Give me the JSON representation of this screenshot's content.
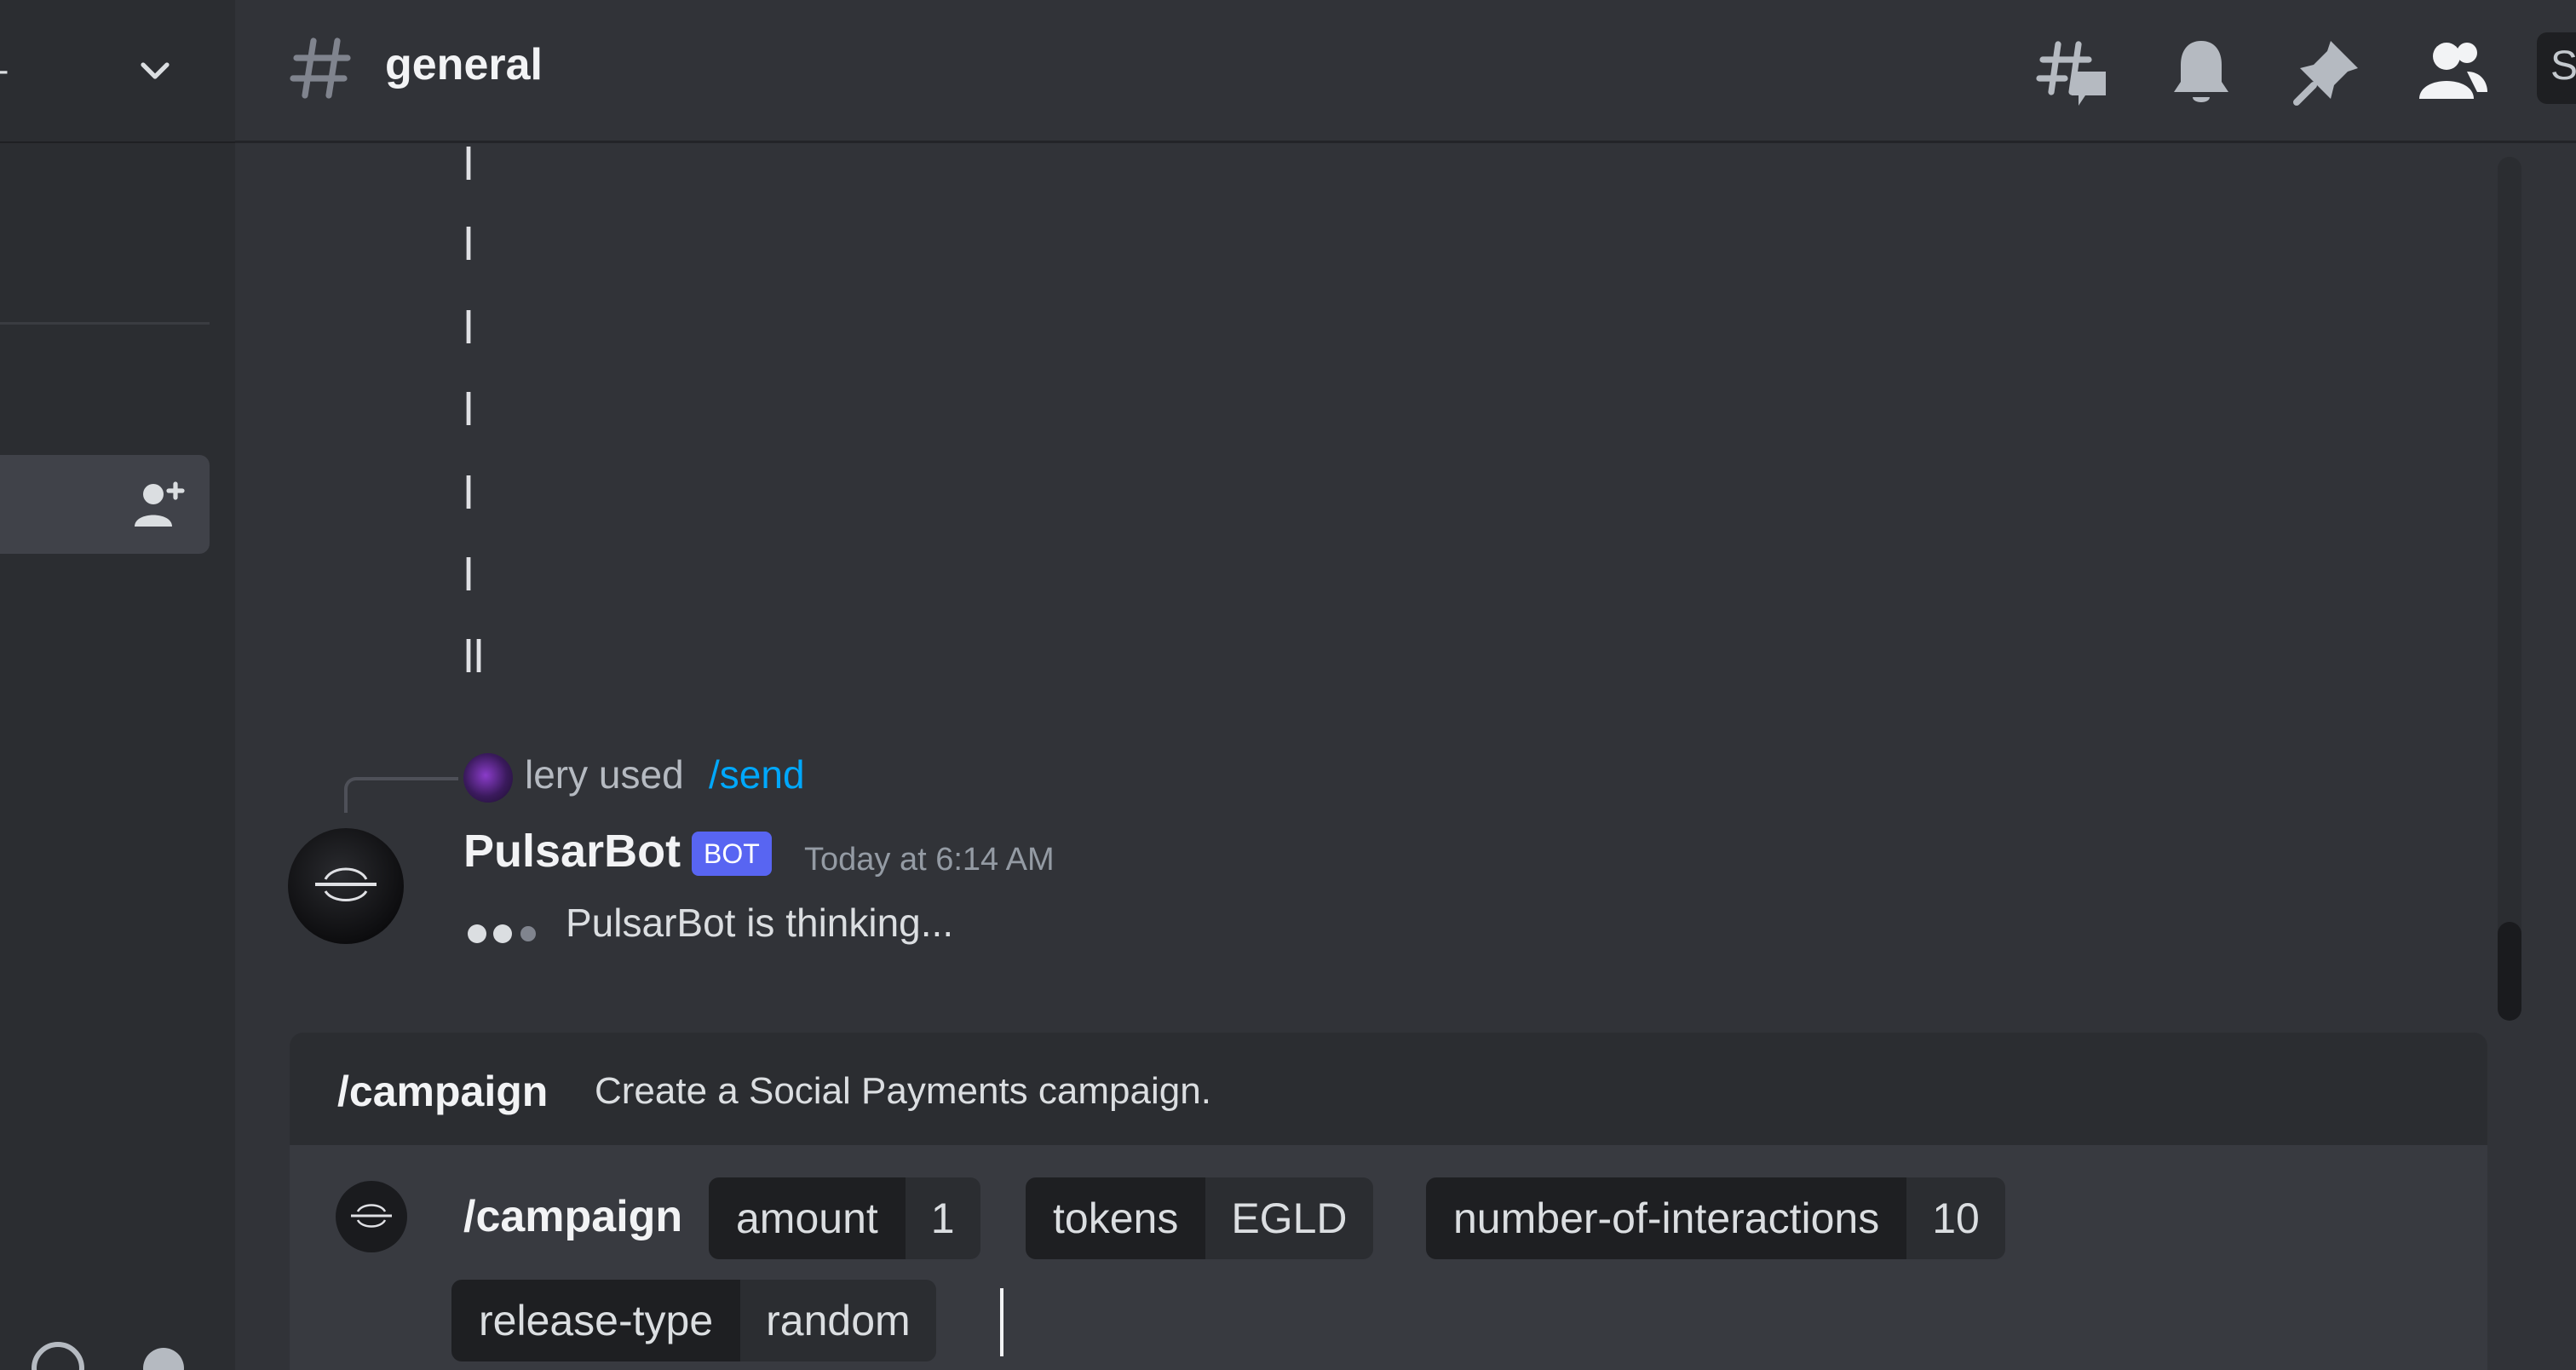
{
  "header": {
    "channel_name": "general",
    "search_stub": "S",
    "icons": [
      "threads-icon",
      "bell-icon",
      "pin-icon",
      "members-icon"
    ]
  },
  "sidebar": {
    "caret_char": "-",
    "invite_icon": "add-member-icon"
  },
  "messages": {
    "lines": [
      "l",
      "l",
      "l",
      "l",
      "l",
      "l",
      "ll"
    ],
    "reply": {
      "user": "lery used",
      "command": "/send"
    },
    "bot": {
      "name": "PulsarBot",
      "badge": "BOT",
      "timestamp": "Today at 6:14 AM",
      "status": "PulsarBot is thinking..."
    }
  },
  "autocomplete": {
    "command": "/campaign",
    "description": "Create a Social Payments campaign."
  },
  "composer": {
    "command": "/campaign",
    "options": [
      {
        "name": "amount",
        "value": "1"
      },
      {
        "name": "tokens",
        "value": "EGLD"
      },
      {
        "name": "number-of-interactions",
        "value": "10"
      },
      {
        "name": "release-type",
        "value": "random"
      }
    ]
  },
  "colors": {
    "background": "#313338",
    "sidebar": "#2b2d31",
    "accent": "#5865f2",
    "link": "#00a8fc"
  }
}
